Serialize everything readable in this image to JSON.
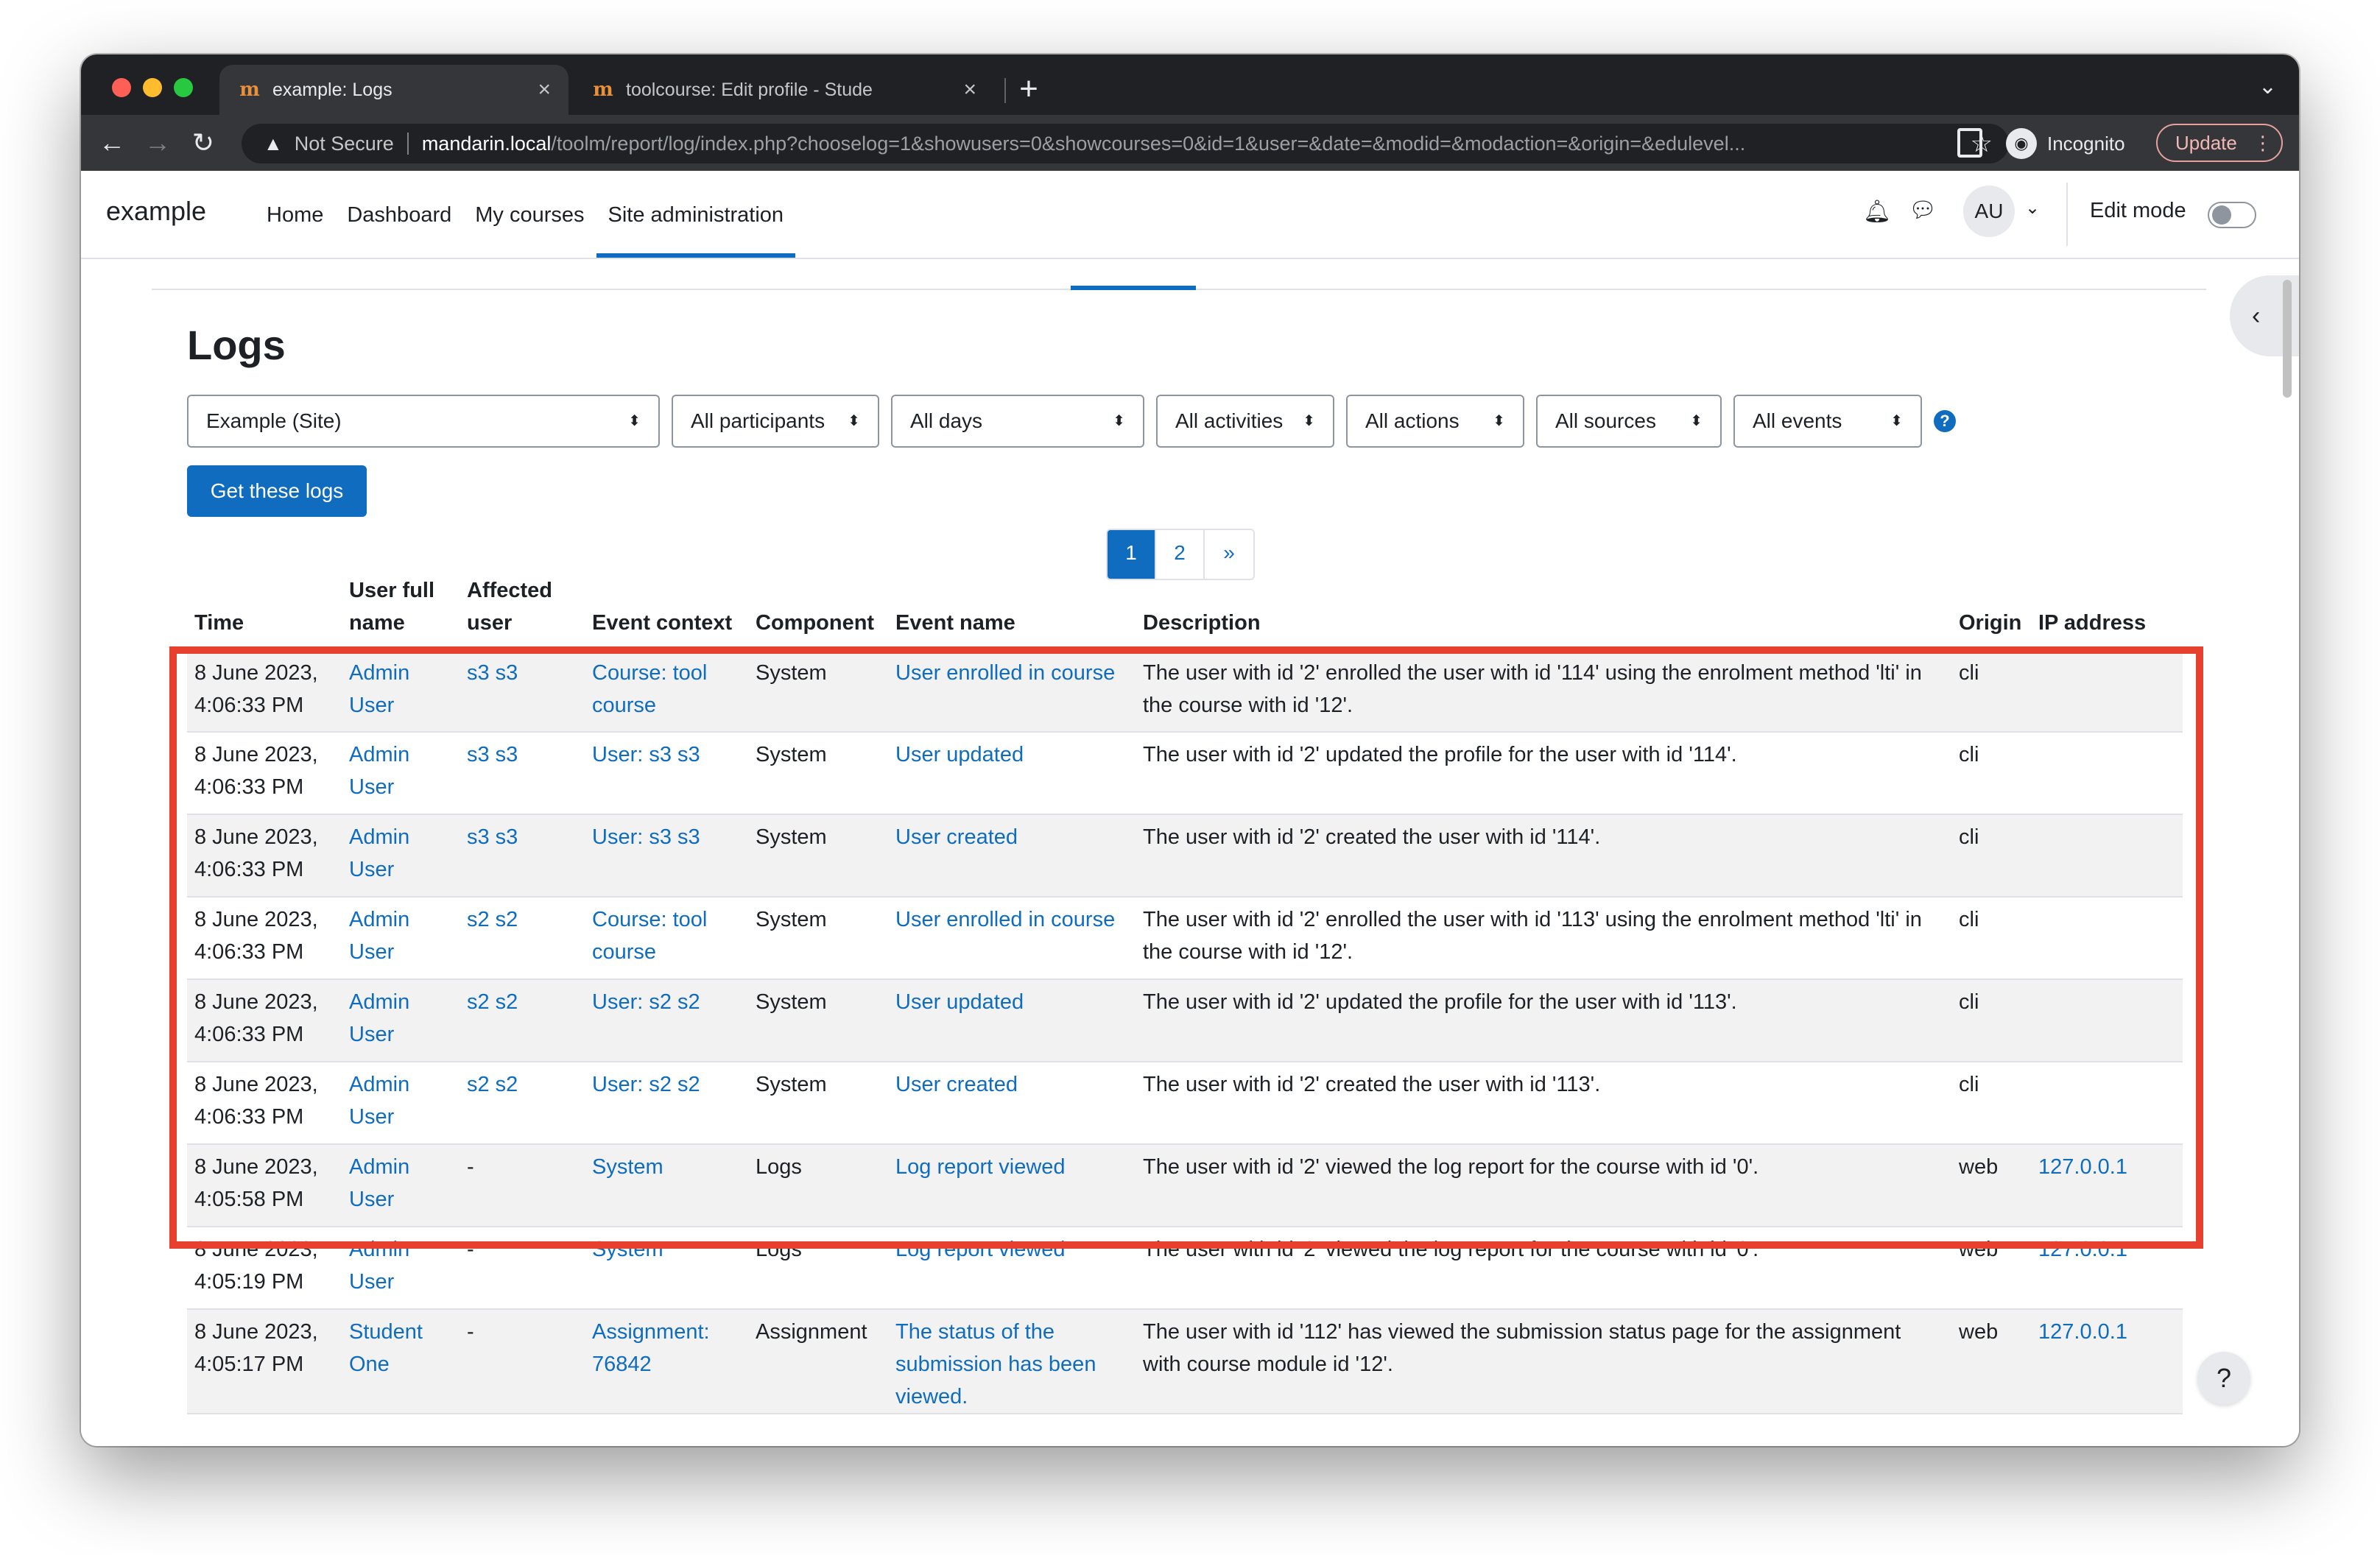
{
  "browser": {
    "tabs": [
      {
        "title": "example: Logs",
        "favicon": "m",
        "close": "×"
      },
      {
        "title": "toolcourse: Edit profile - Stude",
        "favicon": "m",
        "close": "×"
      }
    ],
    "new_tab": "+",
    "tab_menu": "⌄",
    "security_label": "Not Secure",
    "url_host": "mandarin.local",
    "url_path": "/toolm/report/log/index.php?chooselog=1&showusers=0&showcourses=0&id=1&user=&date=&modid=&modaction=&origin=&edulevel...",
    "incognito_label": "Incognito",
    "update_label": "Update",
    "icons": {
      "back": "arrow-left-icon",
      "forward": "arrow-right-icon",
      "reload": "reload-icon",
      "star": "star-icon"
    }
  },
  "navbar": {
    "brand": "example",
    "links": [
      "Home",
      "Dashboard",
      "My courses",
      "Site administration"
    ],
    "active_link": "Site administration",
    "avatar_initials": "AU",
    "edit_mode_label": "Edit mode",
    "edit_mode_on": false
  },
  "page": {
    "title": "Logs",
    "filters": [
      "Example (Site)",
      "All participants",
      "All days",
      "All activities",
      "All actions",
      "All sources",
      "All events"
    ],
    "help_icon": "?",
    "get_logs_label": "Get these logs",
    "pagination": [
      "1",
      "2",
      "»"
    ],
    "current_page": "1",
    "help_fab": "?"
  },
  "table": {
    "headers": {
      "time": "Time",
      "user_full_name": "User full name",
      "affected_user": "Affected user",
      "event_context": "Event context",
      "component": "Component",
      "event_name": "Event name",
      "description": "Description",
      "origin": "Origin",
      "ip_address": "IP address"
    },
    "rows": [
      {
        "time": "8 June 2023, 4:06:33 PM",
        "user": "Admin User",
        "affected": "s3 s3",
        "context": "Course: tool course",
        "component": "System",
        "event": "User enrolled in course",
        "description": "The user with id '2' enrolled the user with id '114' using the enrolment method 'lti' in the course with id '12'.",
        "origin": "cli",
        "ip": ""
      },
      {
        "time": "8 June 2023, 4:06:33 PM",
        "user": "Admin User",
        "affected": "s3 s3",
        "context": "User: s3 s3",
        "component": "System",
        "event": "User updated",
        "description": "The user with id '2' updated the profile for the user with id '114'.",
        "origin": "cli",
        "ip": ""
      },
      {
        "time": "8 June 2023, 4:06:33 PM",
        "user": "Admin User",
        "affected": "s3 s3",
        "context": "User: s3 s3",
        "component": "System",
        "event": "User created",
        "description": "The user with id '2' created the user with id '114'.",
        "origin": "cli",
        "ip": ""
      },
      {
        "time": "8 June 2023, 4:06:33 PM",
        "user": "Admin User",
        "affected": "s2 s2",
        "context": "Course: tool course",
        "component": "System",
        "event": "User enrolled in course",
        "description": "The user with id '2' enrolled the user with id '113' using the enrolment method 'lti' in the course with id '12'.",
        "origin": "cli",
        "ip": ""
      },
      {
        "time": "8 June 2023, 4:06:33 PM",
        "user": "Admin User",
        "affected": "s2 s2",
        "context": "User: s2 s2",
        "component": "System",
        "event": "User updated",
        "description": "The user with id '2' updated the profile for the user with id '113'.",
        "origin": "cli",
        "ip": ""
      },
      {
        "time": "8 June 2023, 4:06:33 PM",
        "user": "Admin User",
        "affected": "s2 s2",
        "context": "User: s2 s2",
        "component": "System",
        "event": "User created",
        "description": "The user with id '2' created the user with id '113'.",
        "origin": "cli",
        "ip": ""
      },
      {
        "time": "8 June 2023, 4:05:58 PM",
        "user": "Admin User",
        "affected": "-",
        "context": "System",
        "component": "Logs",
        "event": "Log report viewed",
        "description": "The user with id '2' viewed the log report for the course with id '0'.",
        "origin": "web",
        "ip": "127.0.0.1"
      },
      {
        "time": "8 June 2023, 4:05:19 PM",
        "user": "Admin User",
        "affected": "-",
        "context": "System",
        "component": "Logs",
        "event": "Log report viewed",
        "description": "The user with id '2' viewed the log report for the course with id '0'.",
        "origin": "web",
        "ip": "127.0.0.1"
      },
      {
        "time": "8 June 2023, 4:05:17 PM",
        "user": "Student One",
        "affected": "-",
        "context": "Assignment: 76842",
        "component": "Assignment",
        "event": "The status of the submission has been viewed.",
        "description": "The user with id '112' has viewed the submission status page for the assignment with course module id '12'.",
        "origin": "web",
        "ip": "127.0.0.1"
      }
    ]
  },
  "colors": {
    "link": "#0f6cbf",
    "primary": "#0f6cbf",
    "highlight": "#e8402e",
    "stripe": "#f2f2f2"
  }
}
